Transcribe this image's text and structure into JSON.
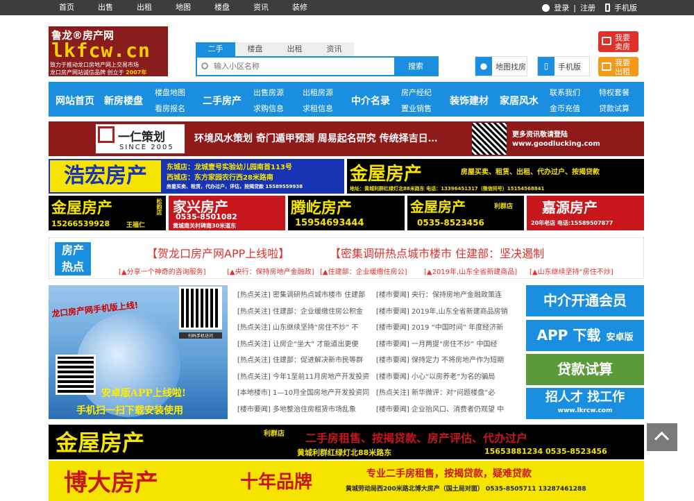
{
  "topnav": [
    "首页",
    "出售",
    "出租",
    "地图",
    "楼盘",
    "资讯",
    "装修"
  ],
  "toplinks": {
    "login": "登录",
    "sep": "|",
    "register": "注册",
    "mobile": "手机版"
  },
  "logo": {
    "line1": "鲁龙®房产网",
    "line2": "lkfcw.cn",
    "line3": "致力于推动龙口房地产网上交易市场",
    "line4a": "龙口房产网站诚信品牌  创立于",
    "line4b": "2007年"
  },
  "search": {
    "tabs": [
      "二手",
      "楼盘",
      "出租",
      "资讯"
    ],
    "placeholder": "输入小区名称",
    "button": "搜索"
  },
  "mapsearch": "地图找房",
  "mobilesite": "手机版",
  "sell": {
    "l1": "我要",
    "l2": "卖房"
  },
  "rent": {
    "l1": "我要",
    "l2": "出租"
  },
  "mainnav": {
    "home": "网站首页",
    "newhouse": "新房楼盘",
    "map": "楼盘地图",
    "apply": "看房报名",
    "secondhand": "二手房产",
    "sale": "出售房源",
    "buy": "求购信息",
    "rentout": "出租房源",
    "rentwant": "求租信息",
    "agents": "中介名录",
    "broker": "房产经纪",
    "owner": "置业销售",
    "decor": "装饰建材",
    "fengshui": "家居风水",
    "contact": "联系我们",
    "recharge": "金币充值",
    "vip": "特权套餐",
    "loan": "贷款试算"
  },
  "banner1": {
    "logo1": "一仁策划",
    "logo2": "SINCE 2005",
    "text": "环境风水策划  奇门遁甲预测  周易起名研究  传统择吉日…",
    "r1": "更多资讯敬请登陆",
    "r2": "www.goodlucking.com"
  },
  "adrow1": {
    "a1": {
      "name": "浩宏房产",
      "l1": "东城店：龙城壹号实验幼儿园南首113号",
      "l2": "西城店：东方家园农行西28米路南",
      "l3": "房屋买卖、租赁，代办过户，评估，按揭贷款 15589559938"
    },
    "a2": {
      "name": "金屋房产",
      "l1": "房屋买卖、租赁、出租、代办过户、按揭贷款",
      "l2": "地址：黄城利群红绿灯北88米路东  电话：13396451317（微信同号）15154568841"
    }
  },
  "adrow2": {
    "a1": {
      "name": "金屋房产",
      "shop": "松韵店",
      "phone": "15266539928",
      "person": "王福仁"
    },
    "a2": {
      "name": "家兴房产",
      "phone": "0535-8501082",
      "addr": "黄城南关村碑南30米道东"
    },
    "a3": {
      "name": "腾屹房产",
      "phone": "15954693444"
    },
    "a4": {
      "name": "金屋房产",
      "shop": "利群店",
      "phone": "0535-8523456"
    },
    "a5": {
      "name": "嘉源房产",
      "sub": "20年老店  电话:15589507877"
    }
  },
  "hot": {
    "label1": "房产",
    "label2": "热点",
    "big1": "【贺龙口房产网APP上线啦】",
    "big2": "【密集调研热点城市楼市 住建部：坚决遏制",
    "small": [
      "[▲分享一个神奇的咨询服务]",
      "[▲央行：保持房地产金融政]",
      "[▲住建部：企业缓缴住房公]",
      "[▲2019年,山东全省新建商品]",
      "[▲山东继续坚持“房住不炒]"
    ]
  },
  "promo": {
    "t1": "龙口房产网手机版上线!",
    "qrlabel": "扫码手机访问",
    "t2": "安卓版APP上线啦!",
    "t3": "手机扫一扫下载安装使用"
  },
  "news_left": [
    "[热点关注] 密集调研热点城市楼市 住建部",
    "[热点关注] 住建部：企业缓缴住房公积金",
    "[热点关注] 山东继续坚持“房住不炒” 不",
    "[热点关注] 让房企“坐大” 才能道出更便",
    "[热点关注] 住建部：促进解决新市民等群",
    "[热点关注] 今年1至前11月房地产开发投资",
    "[本地楼市] 1—10月全国房地产开发投资同",
    "[楼市要闻] 多地整治住房租赁市场乱象"
  ],
  "news_right": [
    "[楼市要闻] 央行：保持房地产金融政策连",
    "[楼市要闻] 2019年,山东全省新建商品房销",
    "[楼市要闻] 2019 “中国时间” 年度经济新",
    "[楼市要闻] 一月两提“房住不炒” 中国经",
    "[楼市要闻] 保持定力 不将房地产作为短期",
    "[楼市要闻] 小心“以房养老”为名的骗局",
    "[热点关注] 新华微评：对“问题楼盘”必",
    "[楼市要闻] 企业抬风口、消费者仍观望 中"
  ],
  "side": {
    "s1": "中介开通会员",
    "s2a": "APP 下载",
    "s2b": "安卓版",
    "s3": "贷款试算",
    "s4": "招人才 找工作",
    "s4url": "www.lkrcw.com"
  },
  "ad3": {
    "name": "金屋房产",
    "shop": "利群店",
    "l1": "二手房租售、按揭贷款、房产评估、代办过户",
    "l2": "黄城利群红绿灯北88米路东",
    "l3": "15653881234  0535-8523456"
  },
  "ad4": {
    "name": "博大房产",
    "slogan": "十年品牌",
    "l1": "专业二手房租售，按揭贷款，疑难贷款",
    "l2": "黄城劳动局西200米路北博大房产（国土局对面） 0535-8505711 13287461288"
  }
}
